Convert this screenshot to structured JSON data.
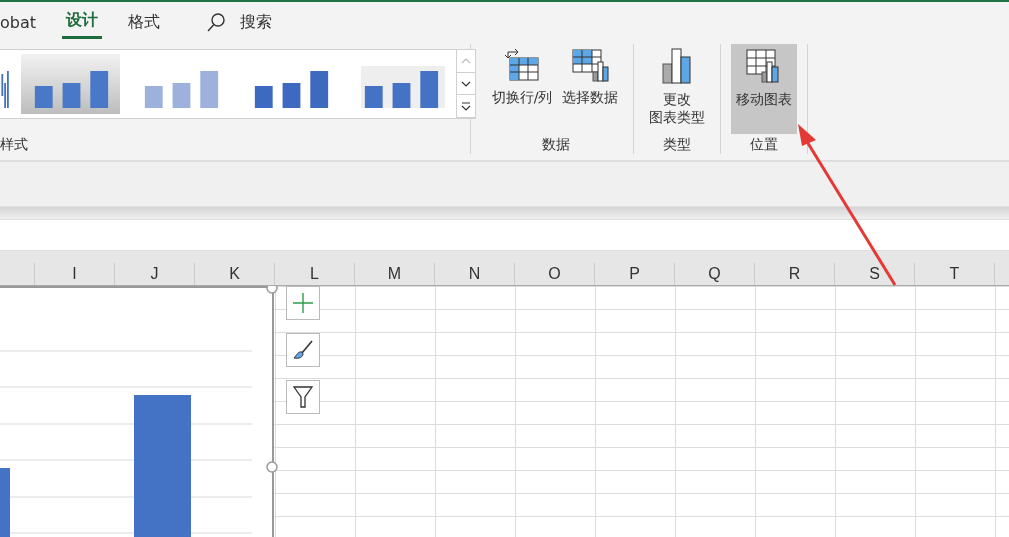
{
  "tabs": [
    {
      "label": "obat",
      "selected": false
    },
    {
      "label": "设计",
      "selected": true
    },
    {
      "label": "格式",
      "selected": false
    }
  ],
  "search": {
    "label": "搜索"
  },
  "chart_styles": {
    "group_label": "样式",
    "styles": [
      {
        "kind": "edge",
        "selected": false
      },
      {
        "kind": "shaded",
        "selected": true
      },
      {
        "kind": "light",
        "selected": false
      },
      {
        "kind": "gradient",
        "selected": false
      },
      {
        "kind": "hatched",
        "selected": false
      }
    ]
  },
  "groups": [
    {
      "label": "数据",
      "buttons": [
        {
          "kind": "switch",
          "lines": [
            "切换行/列"
          ],
          "highlighted": false
        },
        {
          "kind": "select",
          "lines": [
            "选择数据"
          ],
          "highlighted": false
        }
      ]
    },
    {
      "label": "类型",
      "buttons": [
        {
          "kind": "change",
          "lines": [
            "更改",
            "图表类型"
          ],
          "highlighted": false
        }
      ]
    },
    {
      "label": "位置",
      "buttons": [
        {
          "kind": "move",
          "lines": [
            "移动图表"
          ],
          "highlighted": true
        }
      ]
    }
  ],
  "columns": [
    "I",
    "J",
    "K",
    "L",
    "M",
    "N",
    "O",
    "P",
    "Q",
    "R",
    "S",
    "T"
  ]
}
